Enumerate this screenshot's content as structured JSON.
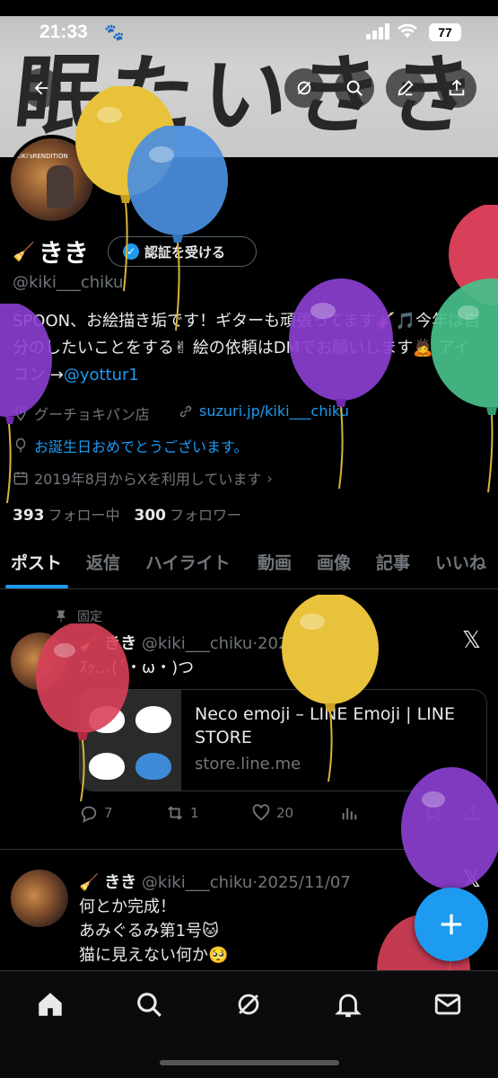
{
  "status_bar": {
    "time": "21:33",
    "battery": "77"
  },
  "banner": {
    "calligraphy": "眠たいきき"
  },
  "profile": {
    "name": "きき",
    "verify_label": "認証を受ける",
    "handle": "@kiki___chiku",
    "bio_part1": "SPOON、お絵描き垢です！ギターも頑張ってます🎸🎵今年は自分のしたいことをする✌ 絵の依頼はDMでお願いします🙇 アイコン →",
    "bio_link": "@yottur1",
    "location": "グーチョキパン店",
    "website": "suzuri.jp/kiki___chiku",
    "birthday": "お誕生日おめでとうございます。",
    "joined": "2019年8月からXを利用しています",
    "following_count": "393",
    "following_label": "フォロー中",
    "followers_count": "300",
    "followers_label": "フォロワー"
  },
  "tabs": [
    "ポスト",
    "返信",
    "ハイライト",
    "動画",
    "画像",
    "記事",
    "いいね"
  ],
  "posts": [
    {
      "pinned_label": "固定",
      "name": "きき",
      "handle": "@kiki___chiku",
      "date": "2021/09/06",
      "text": "ｽｯ…(´・ω・)つ",
      "card": {
        "title": "Neco emoji – LINE Emoji | LINE STORE",
        "domain": "store.line.me"
      },
      "replies": "7",
      "reposts": "1",
      "likes": "20"
    },
    {
      "name": "きき",
      "handle": "@kiki___chiku",
      "date": "2025/11/07",
      "line1": "何とか完成！",
      "line2": "あみぐるみ第1号🐱",
      "line3": "猫に見えない何か🥺"
    }
  ],
  "colors": {
    "accent": "#1d9bf0",
    "background": "#000000",
    "muted": "#71767b"
  },
  "icons": [
    "back-icon",
    "grok-icon",
    "search-icon",
    "compose-icon",
    "share-icon",
    "home-icon",
    "notifications-icon",
    "messages-icon"
  ]
}
